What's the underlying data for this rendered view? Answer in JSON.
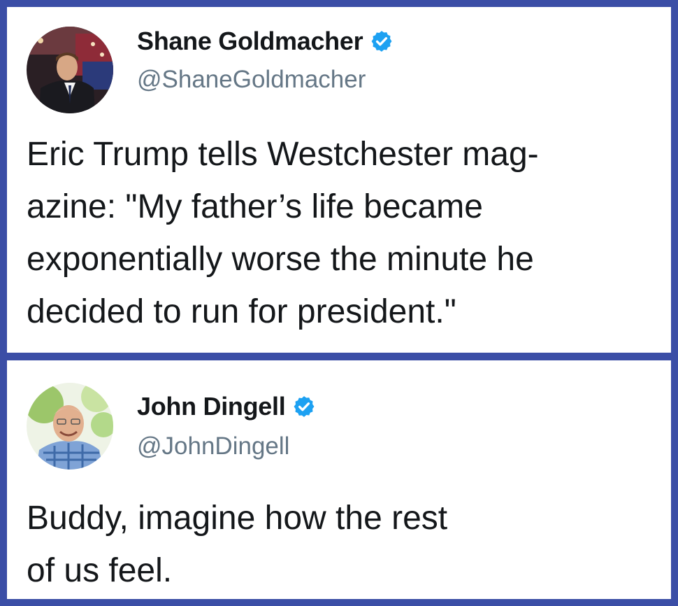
{
  "tweets": [
    {
      "display_name": "Shane Goldmacher",
      "handle": "@ShaneGoldmacher",
      "verified": true,
      "avatar_icon": "profile-photo-man-in-suit-icon",
      "text_lines": [
        "Eric Trump tells Westchester mag-",
        "azine: \"My father’s life became",
        "exponentially worse the minute he",
        "decided to run for president.\""
      ]
    },
    {
      "display_name": "John Dingell",
      "handle": "@JohnDingell",
      "verified": true,
      "avatar_icon": "profile-photo-smiling-older-man-icon",
      "text_lines": [
        "Buddy, imagine how the rest",
        "of us feel."
      ]
    }
  ],
  "colors": {
    "frame_border": "#3b4ea6",
    "card_background": "#ffffff",
    "name_text": "#14171a",
    "handle_text": "#657786",
    "verified_badge": "#1da1f2"
  }
}
